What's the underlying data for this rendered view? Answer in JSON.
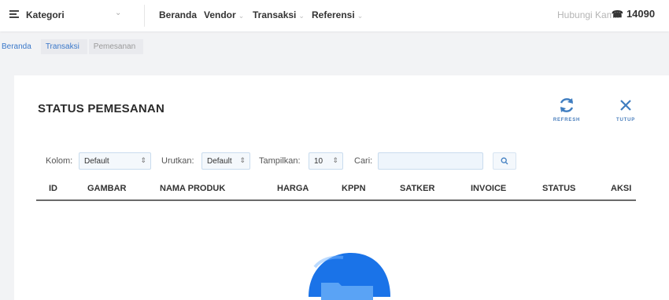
{
  "topbar": {
    "category_label": "Kategori",
    "nav": [
      {
        "label": "Beranda",
        "has_chevron": false
      },
      {
        "label": "Vendor",
        "has_chevron": true
      },
      {
        "label": "Transaksi",
        "has_chevron": true
      },
      {
        "label": "Referensi",
        "has_chevron": true
      }
    ],
    "contact_label": "Hubungi Kami:",
    "phone": "14090"
  },
  "breadcrumb": [
    "Beranda",
    "Transaksi",
    "Pemesanan"
  ],
  "card": {
    "title": "STATUS PEMESANAN",
    "refresh_label": "REFRESH",
    "close_label": "TUTUP"
  },
  "filters": {
    "column_label": "Kolom:",
    "column_value": "Default",
    "sort_label": "Urutkan:",
    "sort_value": "Default",
    "show_label": "Tampilkan:",
    "show_value": "10",
    "search_label": "Cari:",
    "search_value": ""
  },
  "table": {
    "columns": [
      "ID",
      "GAMBAR",
      "NAMA PRODUK",
      "HARGA",
      "KPPN",
      "SATKER",
      "INVOICE",
      "STATUS",
      "AKSI"
    ]
  },
  "colors": {
    "accent": "#3f7dc0",
    "empty_illustration": "#1a73e8"
  }
}
